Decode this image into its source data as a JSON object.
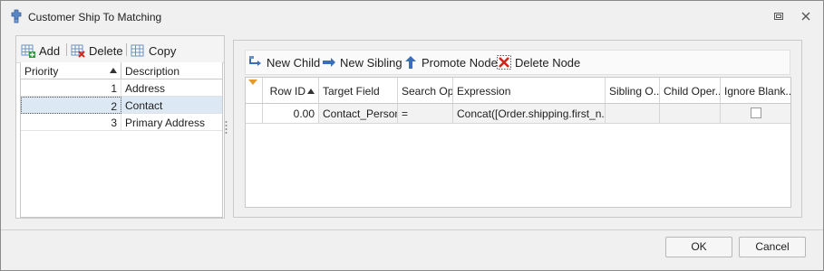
{
  "window": {
    "title": "Customer Ship To Matching",
    "icons": {
      "app": "puzzle-icon",
      "restore": "restore-icon",
      "close": "close-icon"
    }
  },
  "left_toolbar": {
    "add_label": "Add",
    "delete_label": "Delete",
    "copy_label": "Copy",
    "icons": {
      "add": "grid-add-icon",
      "delete": "grid-delete-icon",
      "copy": "grid-copy-icon"
    }
  },
  "left_grid": {
    "columns": [
      "Priority",
      "Description"
    ],
    "sort": "priority-ascending",
    "rows": [
      {
        "priority": "1",
        "description": "Address"
      },
      {
        "priority": "2",
        "description": "Contact"
      },
      {
        "priority": "3",
        "description": "Primary Address"
      }
    ],
    "selected_row": 1
  },
  "right_toolbar": {
    "new_child_label": "New Child",
    "new_sibling_label": "New Sibling",
    "promote_node_label": "Promote Node",
    "delete_node_label": "Delete Node",
    "icons": {
      "new_child": "new-child-icon",
      "new_sibling": "arrow-right-icon",
      "promote": "arrow-up-icon",
      "delete": "red-x-icon"
    }
  },
  "right_grid": {
    "columns": [
      "Row ID",
      "Target Field",
      "Search Op",
      "Expression",
      "Sibling O...",
      "Child Oper...",
      "Ignore Blank..."
    ],
    "rows": [
      {
        "row_id": "0.00",
        "target_field": "Contact_Person",
        "search_op": "=",
        "expression": "Concat([Order.shipping.first_n...",
        "sibling_op": "",
        "child_op": "",
        "ignore_blank": false
      }
    ]
  },
  "buttons": {
    "ok": "OK",
    "cancel": "Cancel"
  },
  "colors": {
    "selected_row": "#dde8f5",
    "accent_blue": "#3b6fb5",
    "red": "#d0261c"
  }
}
